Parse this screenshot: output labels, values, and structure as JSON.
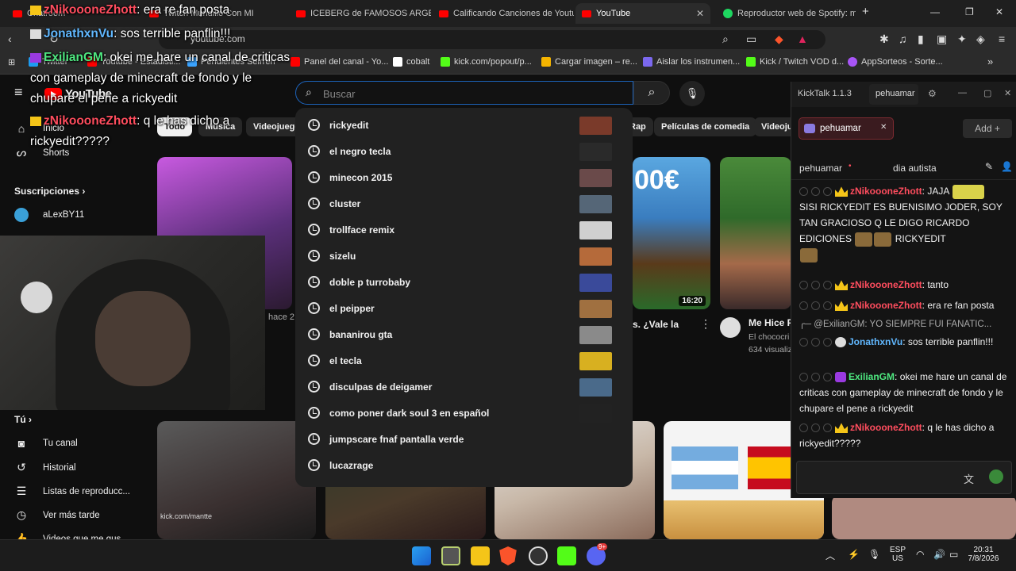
{
  "browser": {
    "tabs": [
      {
        "title": "Chatroom",
        "active": false
      },
      {
        "title": "Twitch Mundillo Con MI",
        "active": false
      },
      {
        "title": "ICEBERG de FAMOSOS ARGEN",
        "active": false
      },
      {
        "title": "Calificando Canciones de Youtu",
        "active": false
      },
      {
        "title": "YouTube",
        "active": true
      },
      {
        "title": "Reproductor web de Spotify: m",
        "active": false
      }
    ],
    "new_tab": "+",
    "url": "youtube.com",
    "bookmarks": [
      {
        "label": "Twitter",
        "color": "#1d9bf0"
      },
      {
        "label": "Youtube - Estadisti...",
        "color": "#ff0000"
      },
      {
        "label": "Pendientes Seirren",
        "color": "#3aa3ff"
      },
      {
        "label": "Panel del canal - Yo...",
        "color": "#ff0000"
      },
      {
        "label": "cobalt",
        "color": "#ffffff"
      },
      {
        "label": "kick.com/popout/p...",
        "color": "#53fc18"
      },
      {
        "label": "Cargar imagen – re...",
        "color": "#f5b400"
      },
      {
        "label": "Aislar los instrumen...",
        "color": "#7b68ee"
      },
      {
        "label": "Kick / Twitch VOD d...",
        "color": "#53fc18"
      },
      {
        "label": "AppSorteos - Sorte...",
        "color": "#a855f7"
      }
    ],
    "bookmarks_more": "»"
  },
  "overlay_chat": [
    {
      "user": "zNikoooneZhott",
      "text": ": era re fan posta",
      "color": "#ff4d5e"
    },
    {
      "user": "JonathxnVu",
      "text": ": sos terrible panflin!!!",
      "color": "#61b8ff"
    },
    {
      "user": "ExilianGM",
      "text": ": okei me hare un canal de criticas",
      "color": "#4ee880"
    },
    {
      "line": "con gameplay de minecraft de fondo y le"
    },
    {
      "line": "chupare el pene a rickyedit"
    },
    {
      "user": "zNikoooneZhott",
      "text": ": q le has dicho a",
      "color": "#ff4d5e"
    },
    {
      "line": "rickyedit?????"
    }
  ],
  "youtube": {
    "logo": "YouTube",
    "search_placeholder": "Buscar",
    "chips": [
      "Todo",
      "Música",
      "Videojuegos",
      "Rap",
      "Películas de comedia",
      "Videoju"
    ],
    "sidebar_top": [
      {
        "label": "Inicio",
        "icon": "home-icon"
      },
      {
        "label": "Shorts",
        "icon": "shorts-icon"
      }
    ],
    "subscriptions_title": "Suscripciones",
    "subscriptions": [
      "aLexBY11"
    ],
    "you_title": "Tú",
    "you_items": [
      {
        "label": "Tu canal",
        "icon": "channel-icon"
      },
      {
        "label": "Historial",
        "icon": "history-icon"
      },
      {
        "label": "Listas de reproducc...",
        "icon": "playlist-icon"
      },
      {
        "label": "Ver más tarde",
        "icon": "clock-icon"
      },
      {
        "label": "Videos que me gus...",
        "icon": "like-icon"
      }
    ],
    "suggestions": [
      {
        "text": "rickyedit",
        "thumb": "#7a3a2a"
      },
      {
        "text": "el negro tecla",
        "thumb": "#2a2a2a"
      },
      {
        "text": "minecon 2015",
        "thumb": "#6a4a4a"
      },
      {
        "text": "cluster",
        "thumb": "#556677"
      },
      {
        "text": "trollface remix",
        "thumb": "#d0d0d0"
      },
      {
        "text": "sizelu",
        "thumb": "#b56a3a"
      },
      {
        "text": "doble p turrobaby",
        "thumb": "#3a4a9a"
      },
      {
        "text": "el peipper",
        "thumb": "#a07040"
      },
      {
        "text": "bananirou gta",
        "thumb": "#8a8a8a"
      },
      {
        "text": "el tecla",
        "thumb": "#d8b020"
      },
      {
        "text": "disculpas de deigamer",
        "thumb": "#4a6a8a"
      },
      {
        "text": "como poner dark soul 3 en español",
        "thumb": "#222222"
      },
      {
        "text": "jumpscare fnaf pantalla verde",
        "thumb": ""
      },
      {
        "text": "lucazrage",
        "thumb": ""
      }
    ],
    "video_texts": {
      "title_partial_1": "s. ¿Vale la",
      "duration_1": "16:20",
      "title_2": "Me Hice F",
      "channel_2": "El chococri",
      "views_2": "634 visualiz",
      "time_1": "hace 2",
      "thumb_text": "00€"
    },
    "webcam_watermark": "kick.com/mantte"
  },
  "kicktalk": {
    "title": "KickTalk 1.1.3",
    "user": "pehuamar",
    "channel_tab": "pehuamar",
    "add_label": "Add",
    "channel_name": "pehuamar",
    "stream_title": "dia autista",
    "messages": [
      {
        "user": "zNikoooneZhott",
        "text": "JAJA",
        "line2": "SISI RICKYEDIT ES BUENISIMO JODER, SOY TAN GRACIOSO Q LE DIGO RICARDO EDICIONES",
        "tail": "RICKYEDIT"
      },
      {
        "user": "zNikoooneZhott",
        "text": "tanto"
      },
      {
        "user": "zNikoooneZhott",
        "text": "era re fan posta"
      },
      {
        "reply": "@ExilianGM: YO SIEMPRE FUI FANATIC..."
      },
      {
        "user": "JonathxnVu",
        "text": "sos terrible panflin!!!"
      },
      {
        "user": "ExilianGM",
        "text": "okei me hare un canal de criticas con gameplay de minecraft de fondo y le chupare el pene a rickyedit"
      },
      {
        "user": "zNikoooneZhott",
        "text": "q le has dicho a rickyedit?????"
      }
    ]
  },
  "taskbar": {
    "lang_top": "ESP",
    "lang_bottom": "US",
    "time": "20:31",
    "date": "7/8/2026",
    "discord_badge": "9+"
  }
}
